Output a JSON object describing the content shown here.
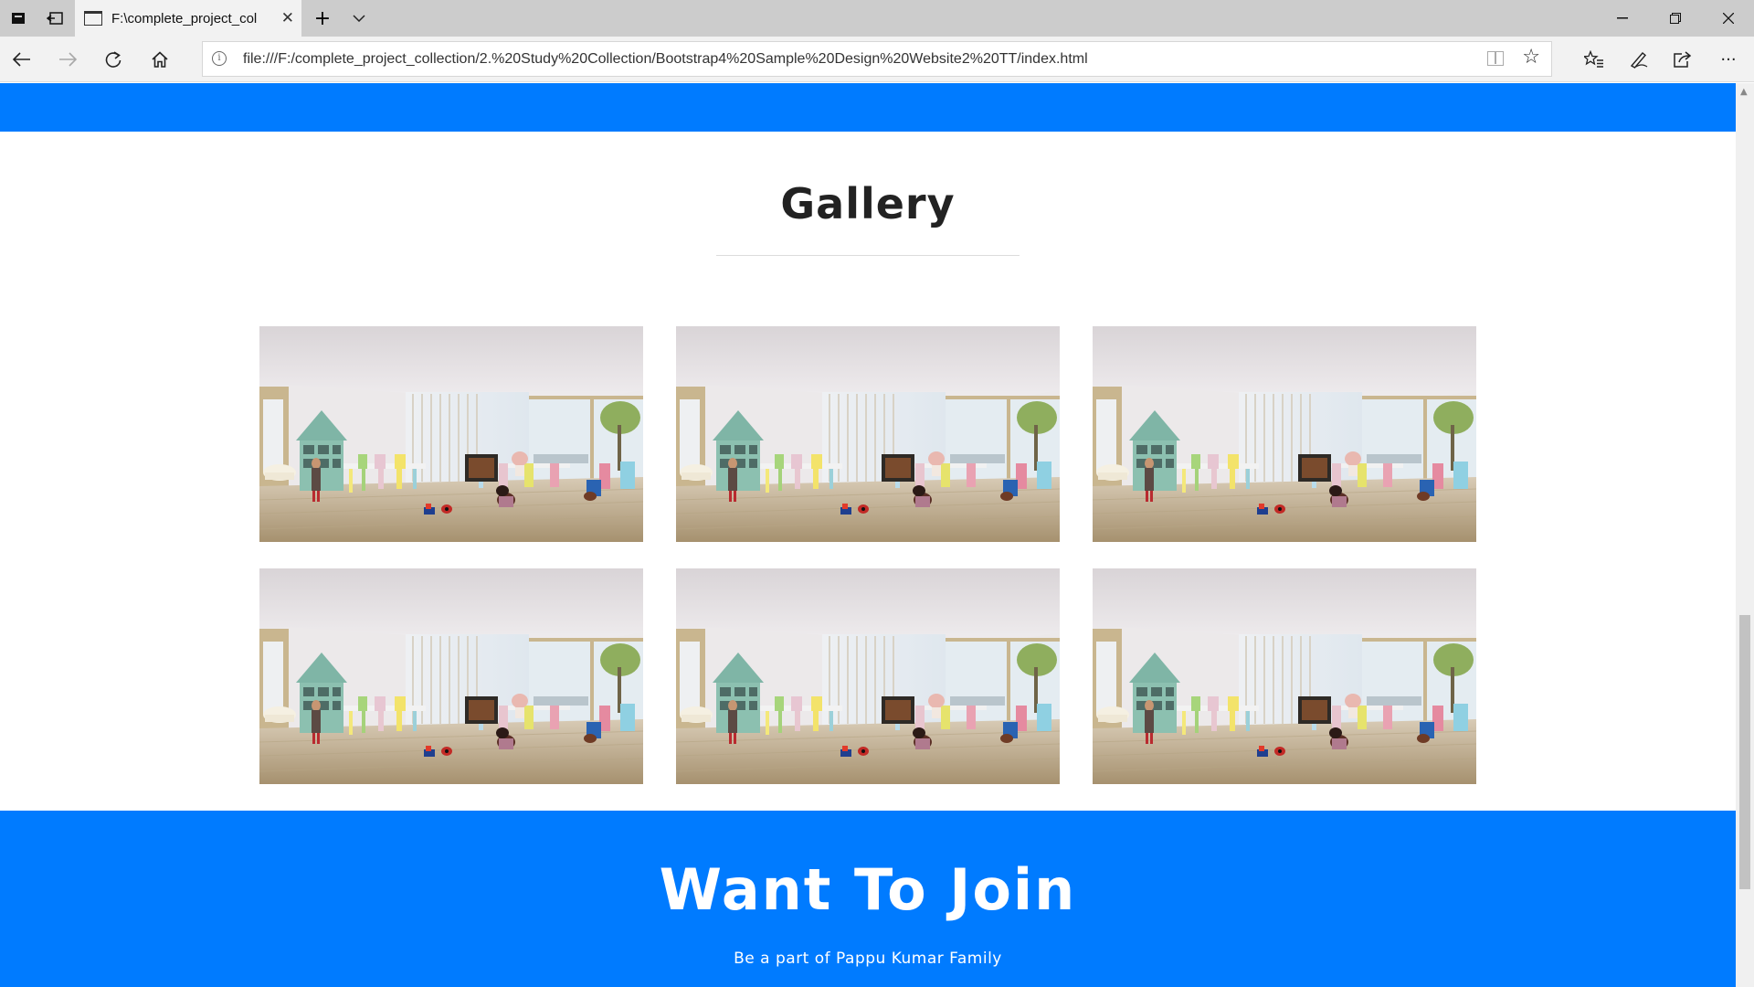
{
  "browser": {
    "tab_title": "F:\\complete_project_col",
    "url": "file:///F:/complete_project_collection/2.%20Study%20Collection/Bootstrap4%20Sample%20Design%20Website2%20TT/index.html"
  },
  "gallery": {
    "title": "Gallery",
    "images": [
      {
        "alt": "classroom-photo"
      },
      {
        "alt": "classroom-photo"
      },
      {
        "alt": "classroom-photo"
      },
      {
        "alt": "classroom-photo"
      },
      {
        "alt": "classroom-photo"
      },
      {
        "alt": "classroom-photo"
      }
    ]
  },
  "join": {
    "title": "Want To Join",
    "subtitle": "Be a part of Pappu Kumar Family"
  },
  "colors": {
    "brand_blue": "#007bff",
    "tabbar": "#cccccc",
    "chrome": "#f2f2f2"
  }
}
